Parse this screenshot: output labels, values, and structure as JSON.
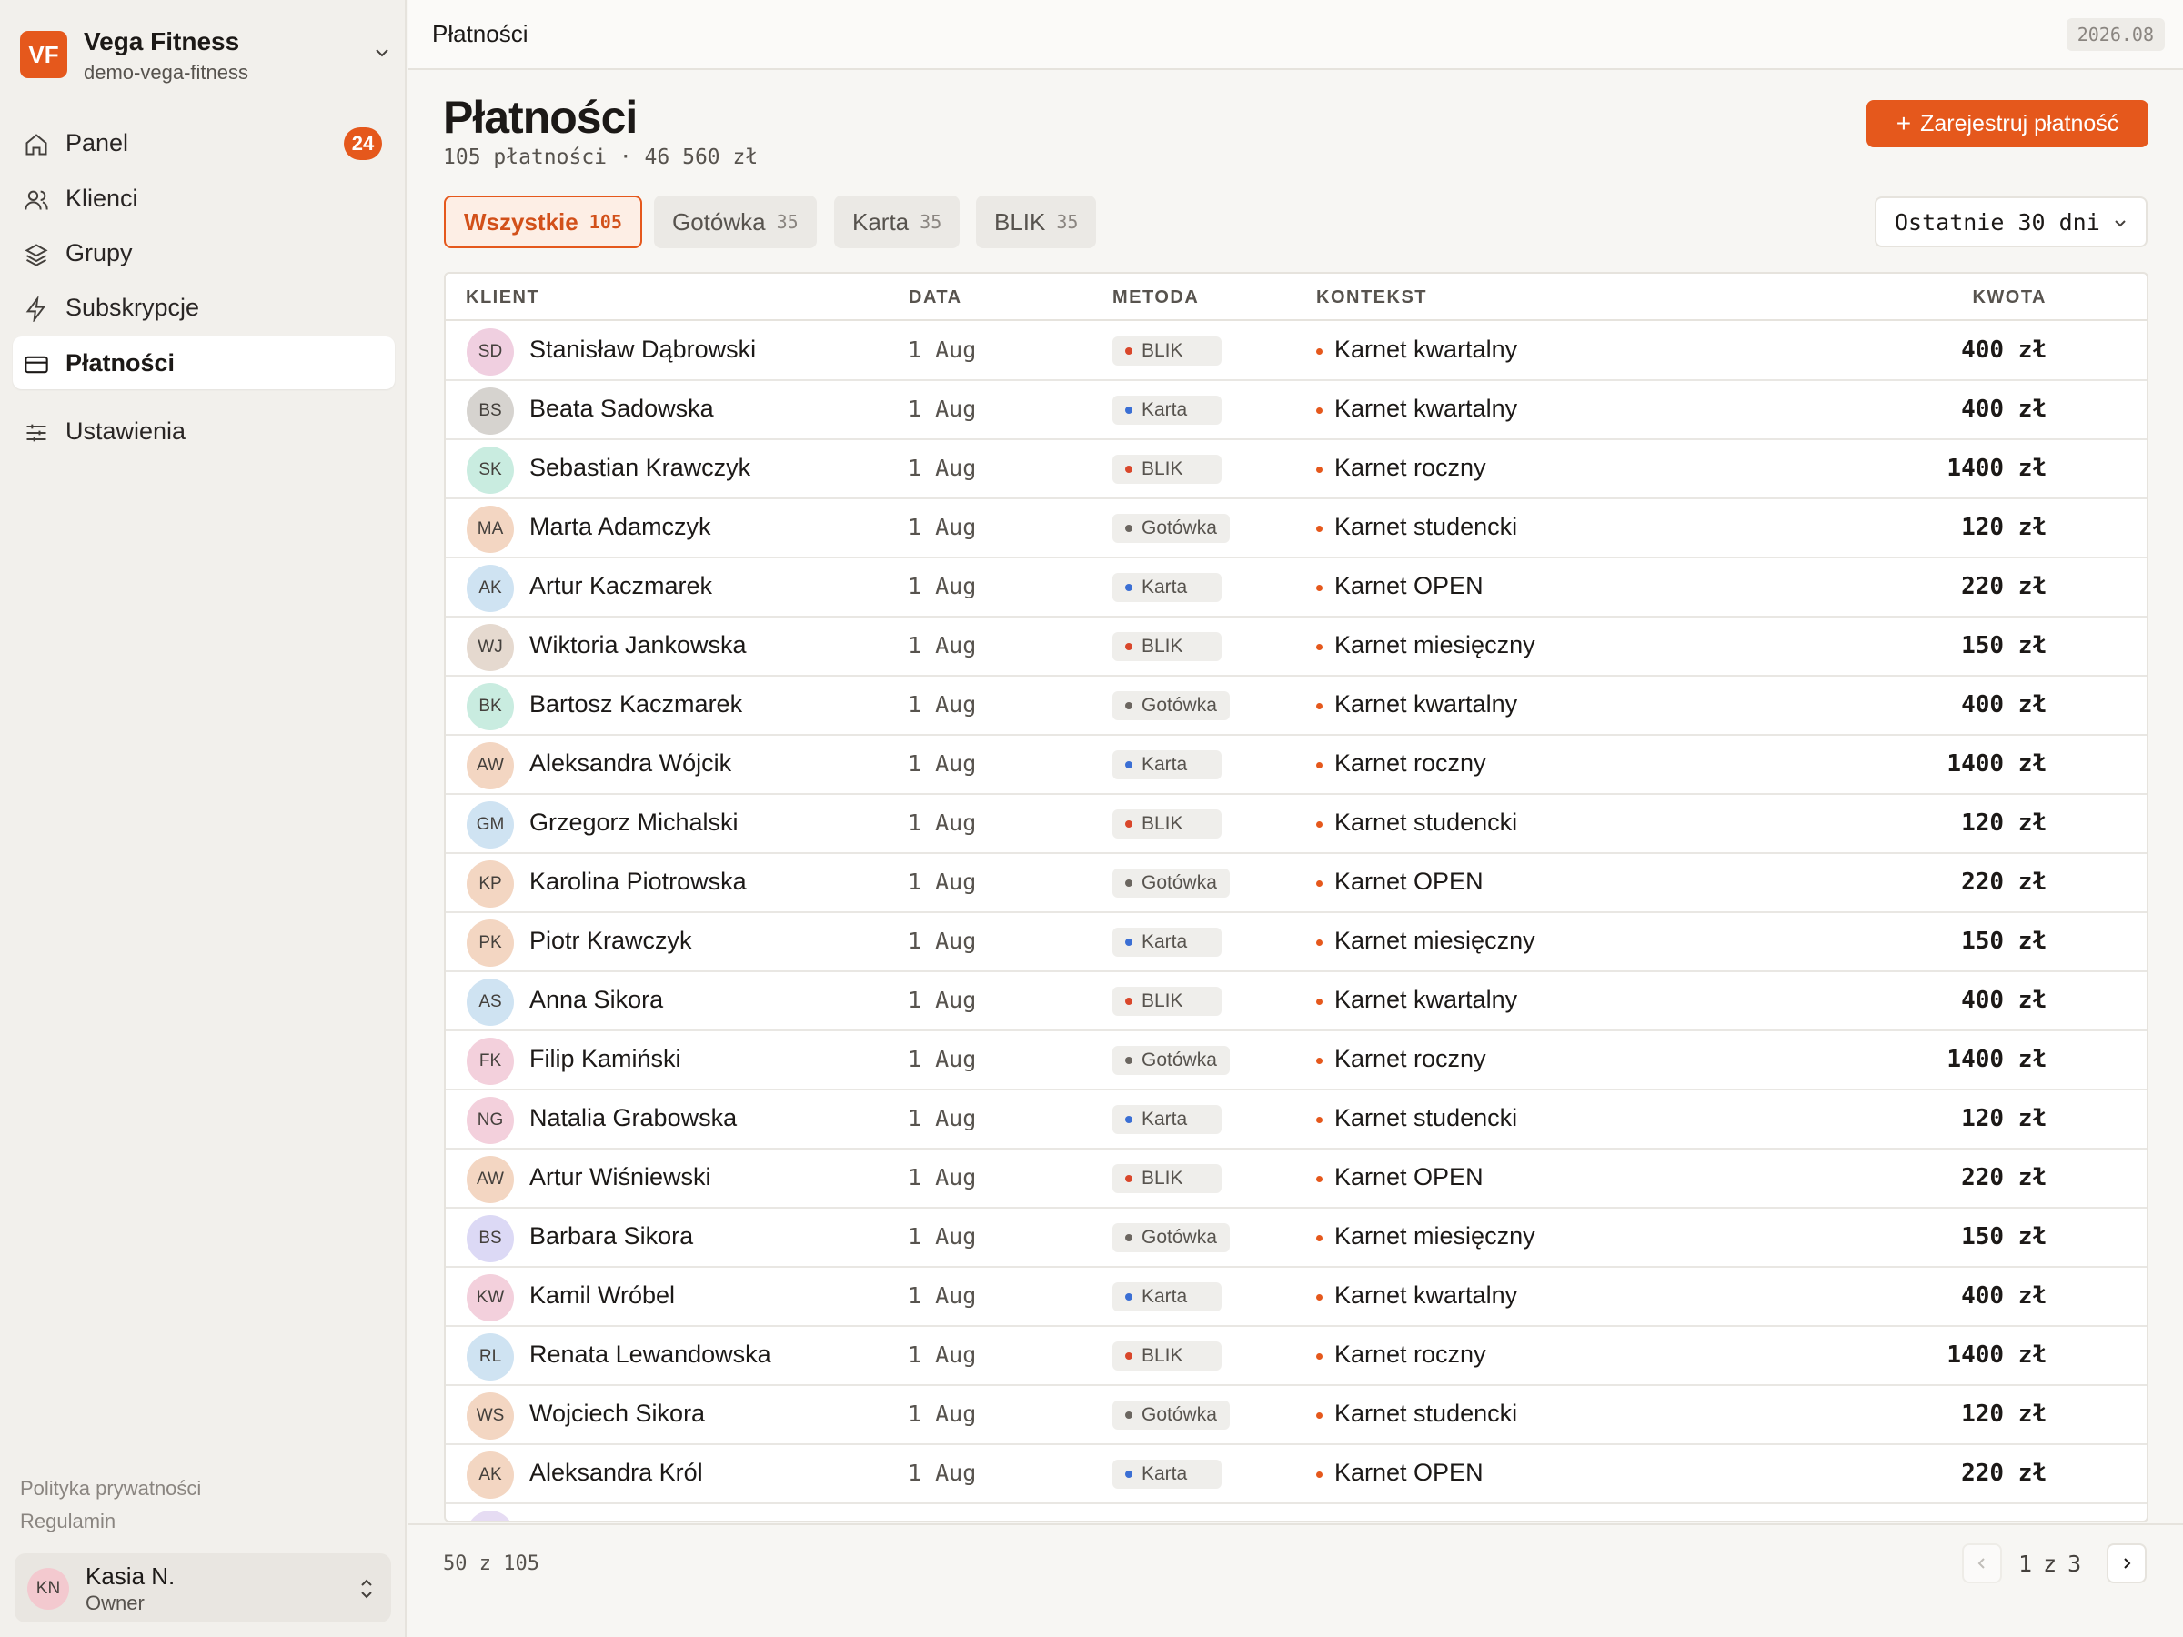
{
  "workspace": {
    "initials": "VF",
    "name": "Vega Fitness",
    "slug": "demo-vega-fitness"
  },
  "nav": [
    {
      "label": "Panel",
      "badge": "24"
    },
    {
      "label": "Klienci"
    },
    {
      "label": "Grupy"
    },
    {
      "label": "Subskrypcje"
    },
    {
      "label": "Płatności"
    },
    {
      "label": "Ustawienia"
    }
  ],
  "footer_links": {
    "privacy": "Polityka prywatności",
    "terms": "Regulamin"
  },
  "user": {
    "initials": "KN",
    "name": "Kasia N.",
    "role": "Owner"
  },
  "topbar": {
    "title": "Płatności",
    "period": "2026.08"
  },
  "page": {
    "title": "Płatności",
    "subtitle": "105 płatności · 46 560 zł",
    "register_button": "Zarejestruj płatność"
  },
  "filters": [
    {
      "label": "Wszystkie",
      "count": "105"
    },
    {
      "label": "Gotówka",
      "count": "35"
    },
    {
      "label": "Karta",
      "count": "35"
    },
    {
      "label": "BLIK",
      "count": "35"
    }
  ],
  "range": {
    "label": "Ostatnie 30 dni"
  },
  "table": {
    "columns": {
      "client": "KLIENT",
      "date": "DATA",
      "method": "METODA",
      "context": "KONTEKST",
      "amount": "KWOTA"
    },
    "rows": [
      {
        "initials": "SD",
        "name": "Stanisław Dąbrowski",
        "date": "1 Aug",
        "method": "BLIK",
        "context": "Karnet kwartalny",
        "amount": "400 zł"
      },
      {
        "initials": "BS",
        "name": "Beata Sadowska",
        "date": "1 Aug",
        "method": "Karta",
        "context": "Karnet kwartalny",
        "amount": "400 zł"
      },
      {
        "initials": "SK",
        "name": "Sebastian Krawczyk",
        "date": "1 Aug",
        "method": "BLIK",
        "context": "Karnet roczny",
        "amount": "1400 zł"
      },
      {
        "initials": "MA",
        "name": "Marta Adamczyk",
        "date": "1 Aug",
        "method": "Gotówka",
        "context": "Karnet studencki",
        "amount": "120 zł"
      },
      {
        "initials": "AK",
        "name": "Artur Kaczmarek",
        "date": "1 Aug",
        "method": "Karta",
        "context": "Karnet OPEN",
        "amount": "220 zł"
      },
      {
        "initials": "WJ",
        "name": "Wiktoria Jankowska",
        "date": "1 Aug",
        "method": "BLIK",
        "context": "Karnet miesięczny",
        "amount": "150 zł"
      },
      {
        "initials": "BK",
        "name": "Bartosz Kaczmarek",
        "date": "1 Aug",
        "method": "Gotówka",
        "context": "Karnet kwartalny",
        "amount": "400 zł"
      },
      {
        "initials": "AW",
        "name": "Aleksandra Wójcik",
        "date": "1 Aug",
        "method": "Karta",
        "context": "Karnet roczny",
        "amount": "1400 zł"
      },
      {
        "initials": "GM",
        "name": "Grzegorz Michalski",
        "date": "1 Aug",
        "method": "BLIK",
        "context": "Karnet studencki",
        "amount": "120 zł"
      },
      {
        "initials": "KP",
        "name": "Karolina Piotrowska",
        "date": "1 Aug",
        "method": "Gotówka",
        "context": "Karnet OPEN",
        "amount": "220 zł"
      },
      {
        "initials": "PK",
        "name": "Piotr Krawczyk",
        "date": "1 Aug",
        "method": "Karta",
        "context": "Karnet miesięczny",
        "amount": "150 zł"
      },
      {
        "initials": "AS",
        "name": "Anna Sikora",
        "date": "1 Aug",
        "method": "BLIK",
        "context": "Karnet kwartalny",
        "amount": "400 zł"
      },
      {
        "initials": "FK",
        "name": "Filip Kamiński",
        "date": "1 Aug",
        "method": "Gotówka",
        "context": "Karnet roczny",
        "amount": "1400 zł"
      },
      {
        "initials": "NG",
        "name": "Natalia Grabowska",
        "date": "1 Aug",
        "method": "Karta",
        "context": "Karnet studencki",
        "amount": "120 zł"
      },
      {
        "initials": "AW",
        "name": "Artur Wiśniewski",
        "date": "1 Aug",
        "method": "BLIK",
        "context": "Karnet OPEN",
        "amount": "220 zł"
      },
      {
        "initials": "BS",
        "name": "Barbara Sikora",
        "date": "1 Aug",
        "method": "Gotówka",
        "context": "Karnet miesięczny",
        "amount": "150 zł"
      },
      {
        "initials": "KW",
        "name": "Kamil Wróbel",
        "date": "1 Aug",
        "method": "Karta",
        "context": "Karnet kwartalny",
        "amount": "400 zł"
      },
      {
        "initials": "RL",
        "name": "Renata Lewandowska",
        "date": "1 Aug",
        "method": "BLIK",
        "context": "Karnet roczny",
        "amount": "1400 zł"
      },
      {
        "initials": "WS",
        "name": "Wojciech Sikora",
        "date": "1 Aug",
        "method": "Gotówka",
        "context": "Karnet studencki",
        "amount": "120 zł"
      },
      {
        "initials": "AK",
        "name": "Aleksandra Król",
        "date": "1 Aug",
        "method": "Karta",
        "context": "Karnet OPEN",
        "amount": "220 zł"
      }
    ]
  },
  "pagination": {
    "shown": "50 z 105",
    "page": "1",
    "of": "z",
    "total": "3"
  },
  "colors": {
    "accent": "#e5581c",
    "method_blik": "#d9472b",
    "method_karta": "#3b6fd4",
    "method_gotowka": "#6b6660",
    "avatar_palette": [
      "#f0cfe0",
      "#d6d3cf",
      "#c9ece0",
      "#f3d6c2",
      "#cfe3f2",
      "#e5d9cf",
      "#c9ece0",
      "#f3d6c2",
      "#cfe3f2",
      "#f3d6c2",
      "#f3d6c2",
      "#cfe3f2",
      "#f3d0dc",
      "#f3d0dc",
      "#f3d6c2",
      "#dcd9f5",
      "#f3d0dc",
      "#cfe3f2",
      "#f3d6c2",
      "#f3d6c2"
    ]
  },
  "icons": {
    "nav": [
      "home-icon",
      "users-icon",
      "layers-icon",
      "bolt-icon",
      "credit-card-icon",
      "sliders-icon"
    ]
  }
}
